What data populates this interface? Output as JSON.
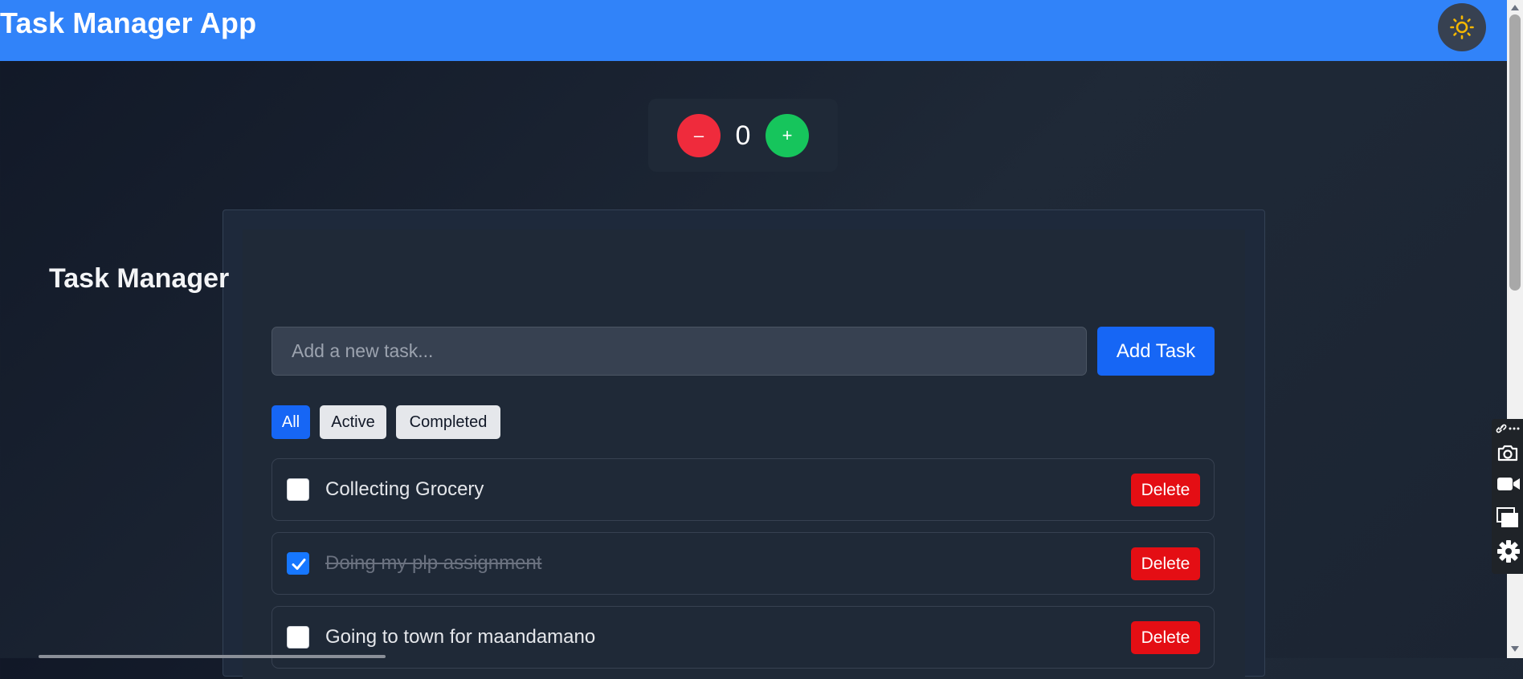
{
  "navbar": {
    "app_title": "Task Manager App",
    "theme_icon": "sun-icon",
    "accent_color": "#3183f9"
  },
  "counter": {
    "decrement_label": "–",
    "increment_label": "+",
    "value": "0"
  },
  "task_manager": {
    "title": "Task Manager",
    "input_placeholder": "Add a new task...",
    "add_button_label": "Add Task",
    "filters": [
      {
        "label": "All",
        "selected": true
      },
      {
        "label": "Active",
        "selected": false
      },
      {
        "label": "Completed",
        "selected": false
      }
    ],
    "tasks": [
      {
        "text": "Collecting Grocery",
        "completed": false,
        "delete_label": "Delete"
      },
      {
        "text": "Doing my plp assignment",
        "completed": true,
        "delete_label": "Delete"
      },
      {
        "text": "Going to town for maandamano",
        "completed": false,
        "delete_label": "Delete"
      }
    ]
  },
  "side_toolbar": {
    "icons": [
      "link-icon",
      "more-icon",
      "camera-icon",
      "video-icon",
      "windows-icon",
      "settings-icon"
    ]
  },
  "colors": {
    "primary_button": "#1666f5",
    "delete_button": "#e40e14",
    "decrement_button": "#ef2b3c",
    "increment_button": "#16c55c"
  }
}
